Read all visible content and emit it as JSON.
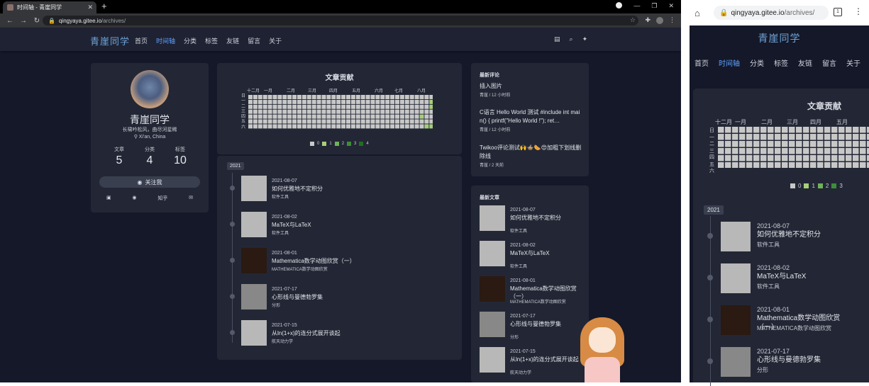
{
  "browser": {
    "tab_title": "时间轴 - 青崖同学",
    "url_host": "qingyaya.gitee.io",
    "url_path": "/archives/"
  },
  "site": {
    "brand": "青崖同学",
    "menu": [
      "首页",
      "时间轴",
      "分类",
      "标签",
      "友链",
      "留言",
      "关于"
    ],
    "active_index": 1
  },
  "profile": {
    "name": "青崖同学",
    "motto": "长啸吟松风，曲尽河星稀",
    "location": "Xi'an, China",
    "stats": [
      {
        "label": "文章",
        "value": "5"
      },
      {
        "label": "分类",
        "value": "4"
      },
      {
        "label": "标签",
        "value": "10"
      }
    ],
    "follow_label": "关注我",
    "socials": [
      "知乎"
    ]
  },
  "contrib": {
    "title": "文章贡献",
    "months": [
      "十二月",
      "一月",
      "二月",
      "三月",
      "四月",
      "五月",
      "六月",
      "七月",
      "八月"
    ],
    "days": [
      "日",
      "一",
      "二",
      "三",
      "四",
      "五",
      "六"
    ],
    "legend": [
      "0",
      "1",
      "2",
      "3",
      "4"
    ],
    "colors": [
      "#c8c8c8",
      "#a7cf7a",
      "#6fb257",
      "#3c8e3a",
      "#216e21"
    ],
    "active_cells": [
      {
        "col": 37,
        "row": 1,
        "level": 1
      },
      {
        "col": 37,
        "row": 2,
        "level": 1
      },
      {
        "col": 37,
        "row": 6,
        "level": 1
      },
      {
        "col": 35,
        "row": 4,
        "level": 1
      },
      {
        "col": 36,
        "row": 6,
        "level": 1
      }
    ],
    "weeks": 38
  },
  "timeline": {
    "year": "2021",
    "posts": [
      {
        "date": "2021-08-07",
        "title": "如何优雅地不定积分",
        "category": "软件工具",
        "thumb": "light"
      },
      {
        "date": "2021-08-02",
        "title": "MaTeX与LaTeX",
        "category": "软件工具",
        "thumb": "light"
      },
      {
        "date": "2021-08-01",
        "title": "Mathematica数学动图欣赏（一）",
        "category": "MATHEMATICA数学动图欣赏",
        "thumb": "dark"
      },
      {
        "date": "2021-07-17",
        "title": "心形线与曼德勃罗集",
        "category": "分形",
        "thumb": "blue"
      },
      {
        "date": "2021-07-15",
        "title": "从ln(1+x)的连分式展开谈起",
        "category": "航天动力学",
        "thumb": "light"
      }
    ]
  },
  "comments": {
    "title": "最新评论",
    "items": [
      {
        "text": "插入图片",
        "meta": "青崖 / 12 小时前"
      },
      {
        "text": "C语言 Hello World 测试 #include int main() { printf(\"Hello World !\"); ret…",
        "meta": "青崖 / 12 小时前"
      },
      {
        "text": "Twikoo评论测试🙌🍲🌭😍加粗下划线删除线",
        "meta": "青崖 / 2 天前"
      }
    ]
  },
  "recent": {
    "title": "最新文章",
    "items": [
      {
        "date": "2021-08-07",
        "title": "如何优雅地不定积分",
        "category": "软件工具",
        "thumb": "light"
      },
      {
        "date": "2021-08-02",
        "title": "MaTeX与LaTeX",
        "category": "软件工具",
        "thumb": "light"
      },
      {
        "date": "2021-08-01",
        "title": "Mathematica数学动图欣赏（一）",
        "category": "MATHEMATICA数学动图欣赏",
        "thumb": "dark"
      },
      {
        "date": "2021-07-17",
        "title": "心形线与曼德勃罗集",
        "category": "分形",
        "thumb": "blue"
      },
      {
        "date": "2021-07-15",
        "title": "从ln(1+x)的连分式展开谈起",
        "category": "航天动力学",
        "thumb": "light"
      }
    ]
  },
  "mobile": {
    "url_host": "qingyaya.gitee.io",
    "url_path": "/archives/",
    "tab_count": "1",
    "menu": [
      "首页",
      "时间轴",
      "分类",
      "标签",
      "友链",
      "留言",
      "关于"
    ],
    "contrib_title": "文章贡献",
    "months": [
      "十二月",
      "一月",
      "二月",
      "三月",
      "四月",
      "五月"
    ],
    "days": [
      "日",
      "一",
      "二",
      "三",
      "四",
      "五",
      "六"
    ],
    "legend": [
      "0",
      "1",
      "2",
      "3"
    ],
    "weeks": 24,
    "year": "2021",
    "posts": [
      {
        "date": "2021-08-07",
        "title": "如何优雅地不定积分",
        "category": "软件工具",
        "thumb": "light"
      },
      {
        "date": "2021-08-02",
        "title": "MaTeX与LaTeX",
        "category": "软件工具",
        "thumb": "light"
      },
      {
        "date": "2021-08-01",
        "title": "Mathematica数学动图欣赏（一）",
        "category": "MATHEMATICA数学动图欣赏",
        "thumb": "dark"
      },
      {
        "date": "2021-07-17",
        "title": "心形线与曼德勃罗集",
        "category": "分形",
        "thumb": "blue"
      }
    ]
  }
}
